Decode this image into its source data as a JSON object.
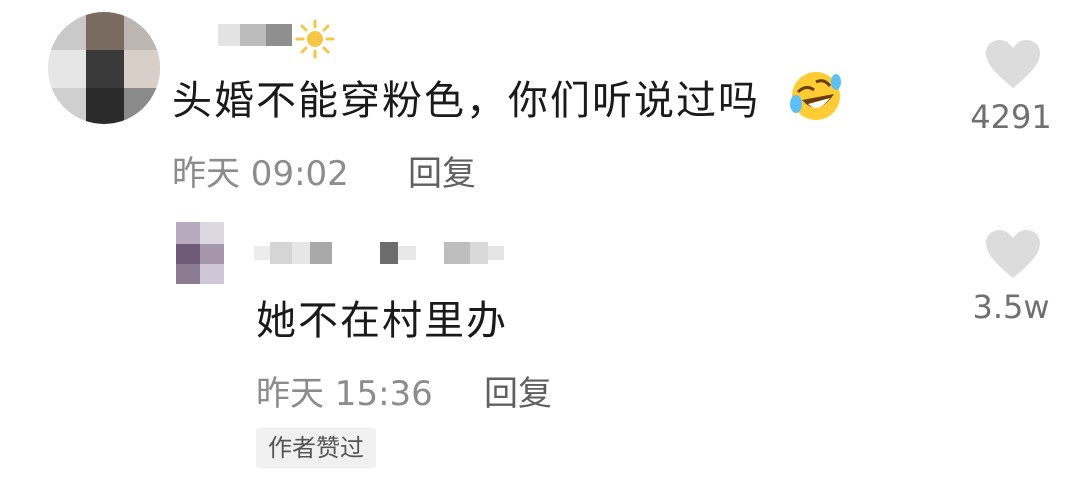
{
  "comment": {
    "text": "头婚不能穿粉色，你们听说过吗",
    "time": "昨天 09:02",
    "reply_label": "回复",
    "likes": "4291",
    "emoji_icon": "rolling-on-floor-laughing-emoji",
    "name_icon": "sun-icon"
  },
  "reply": {
    "text": "她不在村里办",
    "time": "昨天 15:36",
    "reply_label": "回复",
    "likes": "3.5w",
    "badge": "作者赞过"
  },
  "colors": {
    "text": "#1a1a1a",
    "meta": "#8c8c8c",
    "heart": "#dcdcdc",
    "badge_bg": "#f0f0f0"
  }
}
